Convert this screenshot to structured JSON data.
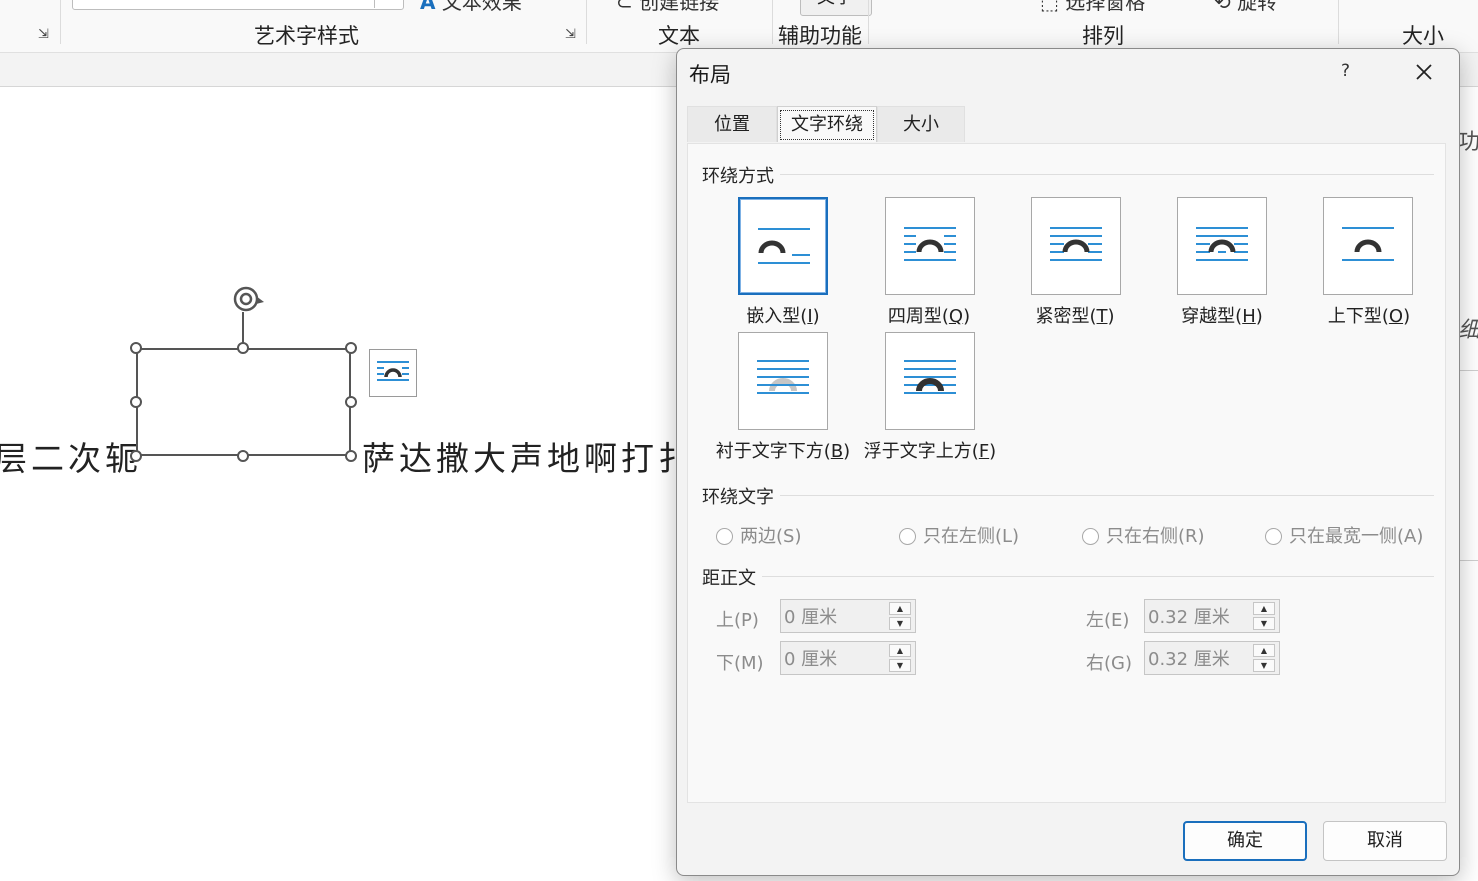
{
  "ribbon": {
    "groups": [
      "艺术字样式",
      "文本",
      "辅助功能",
      "排列",
      "大小"
    ],
    "clipped_items": [
      "文本效果",
      "创建链接",
      "选择窗格",
      "旋转",
      "文字"
    ]
  },
  "document": {
    "text_left": "层二次轭",
    "text_right": "萨达撒大声地啊打扌"
  },
  "right_panel": {
    "clipped_text_1": "功",
    "clipped_text_2": "细"
  },
  "dialog": {
    "title": "布局",
    "help": "?",
    "tabs": [
      {
        "label": "位置",
        "active": false
      },
      {
        "label": "文字环绕",
        "active": true
      },
      {
        "label": "大小",
        "active": false
      }
    ],
    "wrap_style": {
      "title": "环绕方式",
      "options": [
        {
          "label": "嵌入型(",
          "key": "I",
          "suffix": ")",
          "selected": true
        },
        {
          "label": "四周型(",
          "key": "Q",
          "suffix": ")",
          "selected": false
        },
        {
          "label": "紧密型(",
          "key": "T",
          "suffix": ")",
          "selected": false
        },
        {
          "label": "穿越型(",
          "key": "H",
          "suffix": ")",
          "selected": false
        },
        {
          "label": "上下型(",
          "key": "O",
          "suffix": ")",
          "selected": false
        },
        {
          "label": "衬于文字下方(",
          "key": "B",
          "suffix": ")",
          "selected": false
        },
        {
          "label": "浮于文字上方(",
          "key": "F",
          "suffix": ")",
          "selected": false
        }
      ]
    },
    "wrap_text": {
      "title": "环绕文字",
      "options": [
        "两边(S)",
        "只在左侧(L)",
        "只在右侧(R)",
        "只在最宽一侧(A)"
      ]
    },
    "distance": {
      "title": "距正文",
      "top_label": "上(P)",
      "top_value": "0 厘米",
      "bottom_label": "下(M)",
      "bottom_value": "0 厘米",
      "left_label": "左(E)",
      "left_value": "0.32 厘米",
      "right_label": "右(G)",
      "right_value": "0.32 厘米"
    },
    "ok_label": "确定",
    "cancel_label": "取消"
  },
  "colors": {
    "accent": "#1a6fbd",
    "wrap_line": "#2d8fd5",
    "shape_dark": "#333333"
  }
}
